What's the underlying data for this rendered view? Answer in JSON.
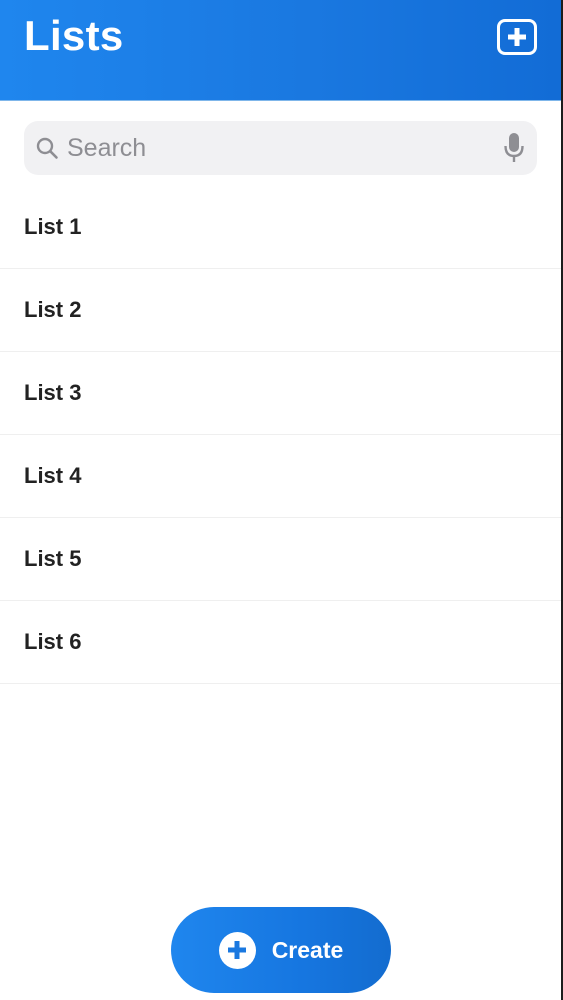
{
  "header": {
    "title": "Lists",
    "add_icon": "plus-square-icon"
  },
  "search": {
    "placeholder": "Search",
    "value": "",
    "icon": "search-icon",
    "mic_icon": "microphone-icon"
  },
  "lists": [
    {
      "label": "List 1"
    },
    {
      "label": "List 2"
    },
    {
      "label": "List 3"
    },
    {
      "label": "List 4"
    },
    {
      "label": "List 5"
    },
    {
      "label": "List 6"
    }
  ],
  "create_button": {
    "label": "Create",
    "icon": "plus-circle-icon"
  },
  "colors": {
    "accent": "#1a78e0",
    "search_background": "#f1f1f3",
    "text": "#222222"
  }
}
